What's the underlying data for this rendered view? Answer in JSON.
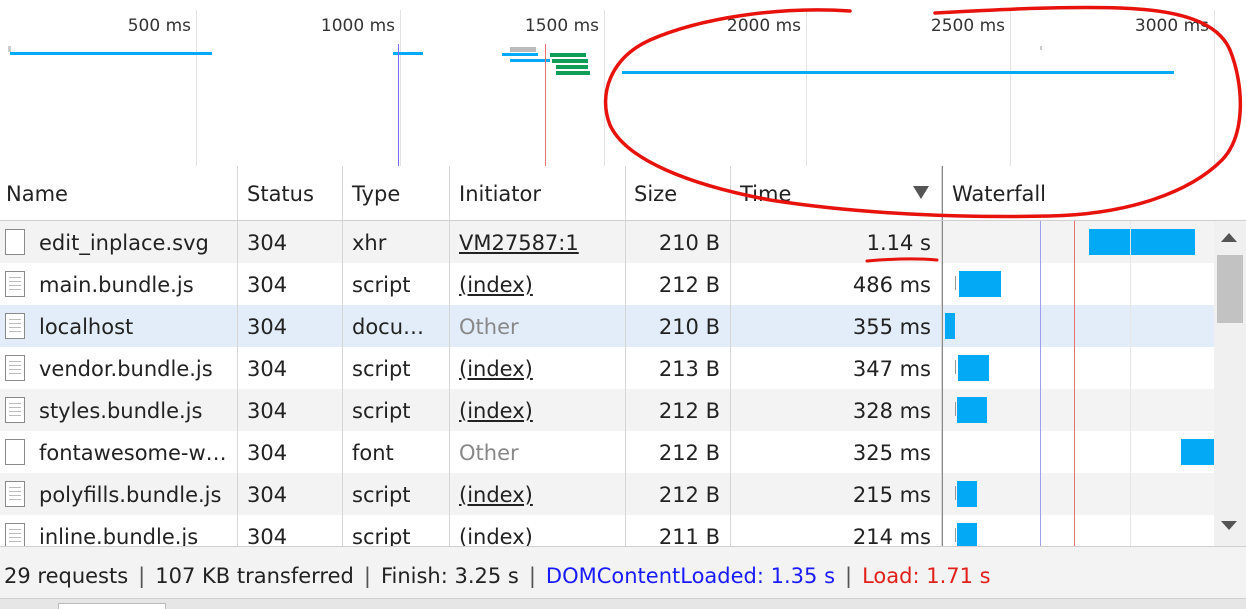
{
  "overview": {
    "ticks": [
      "500 ms",
      "1000 ms",
      "1500 ms",
      "2000 ms",
      "2500 ms",
      "3000 ms"
    ]
  },
  "columns": {
    "name": "Name",
    "status": "Status",
    "type": "Type",
    "initiator": "Initiator",
    "size": "Size",
    "time": "Time",
    "waterfall": "Waterfall"
  },
  "rows": [
    {
      "name": "edit_inplace.svg",
      "status": "304",
      "type": "xhr",
      "initiator": "VM27587:1",
      "size": "210 B",
      "time": "1.14 s"
    },
    {
      "name": "main.bundle.js",
      "status": "304",
      "type": "script",
      "initiator": "(index)",
      "size": "212 B",
      "time": "486 ms"
    },
    {
      "name": "localhost",
      "status": "304",
      "type": "docu…",
      "initiator": "Other",
      "size": "210 B",
      "time": "355 ms"
    },
    {
      "name": "vendor.bundle.js",
      "status": "304",
      "type": "script",
      "initiator": "(index)",
      "size": "213 B",
      "time": "347 ms"
    },
    {
      "name": "styles.bundle.js",
      "status": "304",
      "type": "script",
      "initiator": "(index)",
      "size": "212 B",
      "time": "328 ms"
    },
    {
      "name": "fontawesome-w…",
      "status": "304",
      "type": "font",
      "initiator": "Other",
      "size": "212 B",
      "time": "325 ms"
    },
    {
      "name": "polyfills.bundle.js",
      "status": "304",
      "type": "script",
      "initiator": "(index)",
      "size": "212 B",
      "time": "215 ms"
    },
    {
      "name": "inline.bundle.js",
      "status": "304",
      "type": "script",
      "initiator": "(index)",
      "size": "211 B",
      "time": "214 ms"
    }
  ],
  "status_bar": {
    "requests": "29 requests",
    "transferred": "107 KB transferred",
    "finish": "Finish: 3.25 s",
    "dom_content_loaded": "DOMContentLoaded: 1.35 s",
    "load": "Load: 1.71 s",
    "separator": "|"
  },
  "colors": {
    "bar": "#03a9f4",
    "dcl_line": "#7b6cf6",
    "load_line": "#e53935",
    "selected_row": "#e3edfa",
    "annotation": "#e8120c"
  }
}
